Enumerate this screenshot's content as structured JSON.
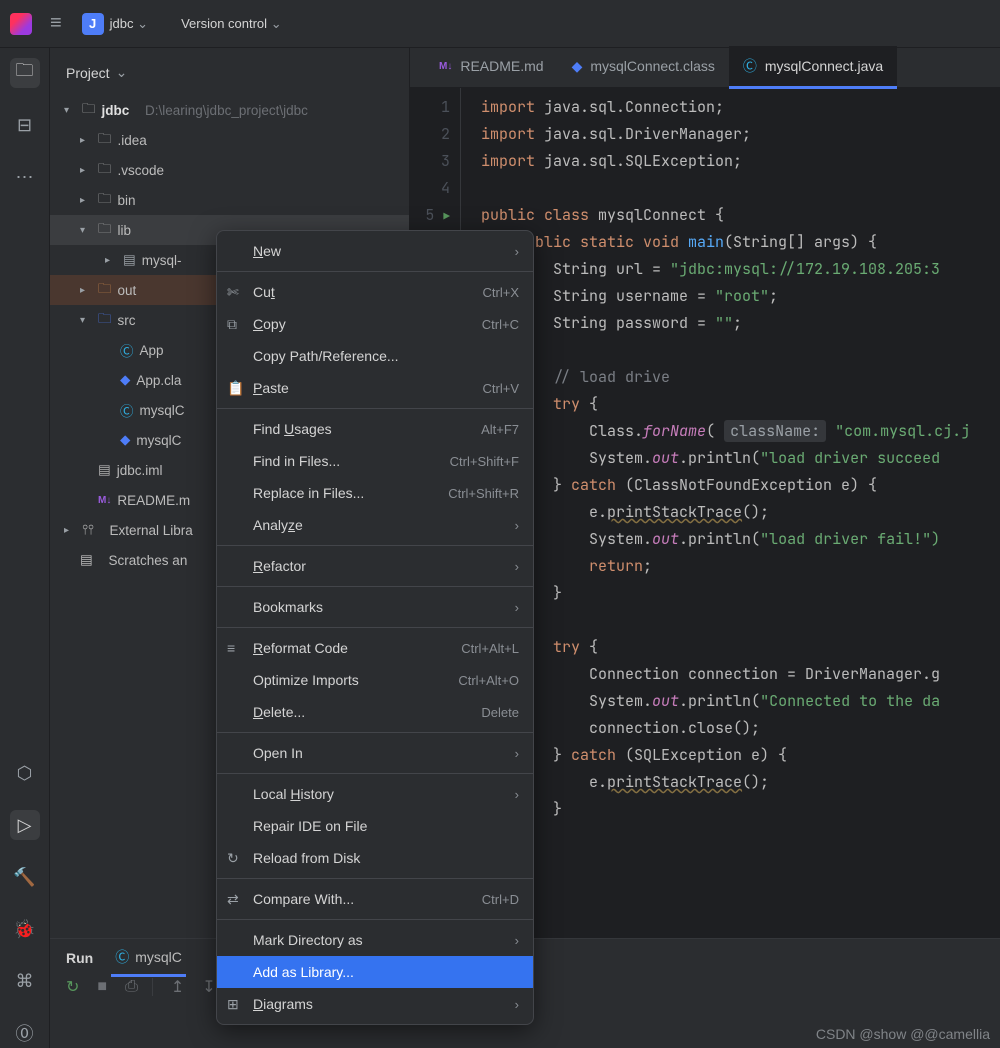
{
  "topbar": {
    "project_initial": "J",
    "project": "jdbc",
    "version_control": "Version control"
  },
  "project_pane": {
    "title": "Project"
  },
  "tree": {
    "root": "jdbc",
    "root_path": "D:\\learing\\jdbc_project\\jdbc",
    "idea": ".idea",
    "vscode": ".vscode",
    "bin": "bin",
    "lib": "lib",
    "mysql_jar": "mysql-",
    "out": "out",
    "src": "src",
    "app": "App",
    "app_class": "App.cla",
    "mysql_conn_java": "mysqlC",
    "mysql_conn_class": "mysqlC",
    "jdbc_iml": "jdbc.iml",
    "readme": "README.m",
    "ext_lib": "External Libra",
    "scratches": "Scratches an"
  },
  "tabs": [
    {
      "icon": "M↓",
      "label": "README.md"
    },
    {
      "icon": "◆",
      "label": "mysqlConnect.class"
    },
    {
      "icon": "Ⓒ",
      "label": "mysqlConnect.java"
    }
  ],
  "code": {
    "line1": {
      "a": "import",
      "b": " java.sql.Connection;"
    },
    "line2": {
      "a": "import",
      "b": " java.sql.DriverManager;"
    },
    "line3": {
      "a": "import",
      "b": " java.sql.SQLException;"
    },
    "line5": {
      "a": "public class ",
      "b": "mysqlConnect {"
    },
    "line6": {
      "a": "public static void ",
      "b": "main",
      "c": "(String[] args) {"
    },
    "line7": {
      "a": "String url = ",
      "b": "\"jdbc:mysql://172.19.108.205:3"
    },
    "line8": {
      "a": "String username = ",
      "b": "\"root\"",
      "c": ";"
    },
    "line9": {
      "a": "String password = ",
      "b": "\"\"",
      "c": ";"
    },
    "line11": "// load drive",
    "line12": {
      "a": "try",
      "b": " {"
    },
    "line13": {
      "a": "Class.",
      "b": "forName",
      "c": "( ",
      "hint": "className:",
      "d": " ",
      "e": "\"com.mysql.cj.j"
    },
    "line14": {
      "a": "System.",
      "b": "out",
      "c": ".println(",
      "d": "\"load driver succeed"
    },
    "line15": {
      "a": "} ",
      "b": "catch",
      "c": " (ClassNotFoundException e) {"
    },
    "line16": {
      "a": "e.",
      "b": "printStackTrace",
      "c": "();"
    },
    "line17": {
      "a": "System.",
      "b": "out",
      "c": ".println(",
      "d": "\"load driver fail!\")"
    },
    "line18": {
      "a": "return",
      "b": ";"
    },
    "line19": "}",
    "line21": {
      "a": "try",
      "b": " {"
    },
    "line22": {
      "a": "Connection connection = DriverManager.",
      "b": "g"
    },
    "line23": {
      "a": "System.",
      "b": "out",
      "c": ".println(",
      "d": "\"Connected to the da"
    },
    "line24": "connection.close();",
    "line25": {
      "a": "} ",
      "b": "catch",
      "c": " (SQLException e) {"
    },
    "line26": {
      "a": "e.",
      "b": "printStackTrace",
      "c": "();"
    },
    "line27": "}"
  },
  "menu": {
    "new": "New",
    "cut": "Cut",
    "cut_sc": "Ctrl+X",
    "copy": "Copy",
    "copy_sc": "Ctrl+C",
    "copy_path": "Copy Path/Reference...",
    "paste": "Paste",
    "paste_sc": "Ctrl+V",
    "find_usages": "Find Usages",
    "find_usages_sc": "Alt+F7",
    "find_files": "Find in Files...",
    "find_files_sc": "Ctrl+Shift+F",
    "replace_files": "Replace in Files...",
    "replace_files_sc": "Ctrl+Shift+R",
    "analyze": "Analyze",
    "refactor": "Refactor",
    "bookmarks": "Bookmarks",
    "reformat": "Reformat Code",
    "reformat_sc": "Ctrl+Alt+L",
    "optimize": "Optimize Imports",
    "optimize_sc": "Ctrl+Alt+O",
    "delete": "Delete...",
    "delete_sc": "Delete",
    "open_in": "Open In",
    "local_history": "Local History",
    "repair": "Repair IDE on File",
    "reload": "Reload from Disk",
    "compare": "Compare With...",
    "compare_sc": "Ctrl+D",
    "mark_dir": "Mark Directory as",
    "add_lib": "Add as Library...",
    "diagrams": "Diagrams"
  },
  "run": {
    "label": "Run",
    "config": "mysqlC"
  },
  "watermark": "CSDN @show @@camellia"
}
